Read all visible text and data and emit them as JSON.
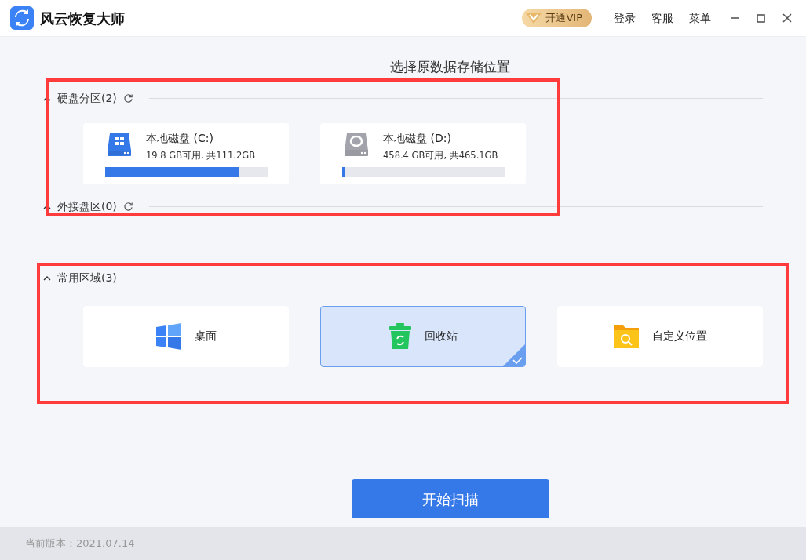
{
  "window": {
    "title": "风云恢复大师"
  },
  "header_actions": [
    {
      "kind": "vip",
      "label": "开通VIP"
    },
    {
      "kind": "link",
      "label": "登录"
    },
    {
      "kind": "link",
      "label": "客服"
    },
    {
      "kind": "link",
      "label": "菜单"
    }
  ],
  "heading": "选择原数据存储位置",
  "sections": [
    {
      "kind": "drives",
      "title": "硬盘分区(2)",
      "expanded": true,
      "refreshable": true,
      "highlighted": true,
      "drives": [
        {
          "kind": "system",
          "name": "本地磁盘 (C:)",
          "usage": "19.8 GB可用, 共111.2GB",
          "level": 0.82
        },
        {
          "kind": "data",
          "name": "本地磁盘 (D:)",
          "usage": "458.4 GB可用, 共465.1GB",
          "level": 0.015
        }
      ]
    },
    {
      "kind": "drives",
      "title": "外接盘区(0)",
      "expanded": true,
      "refreshable": true
    },
    {
      "kind": "locations",
      "title": "常用区域(3)",
      "expanded": true,
      "highlighted": true,
      "locations": [
        {
          "kind": "desktop",
          "label": "桌面",
          "selected": false
        },
        {
          "kind": "recycle",
          "label": "回收站",
          "selected": true
        },
        {
          "kind": "custom",
          "label": "自定义位置",
          "selected": false
        }
      ]
    }
  ],
  "scan_button": "开始扫描",
  "footer": {
    "version": "当前版本：2021.07.14"
  }
}
